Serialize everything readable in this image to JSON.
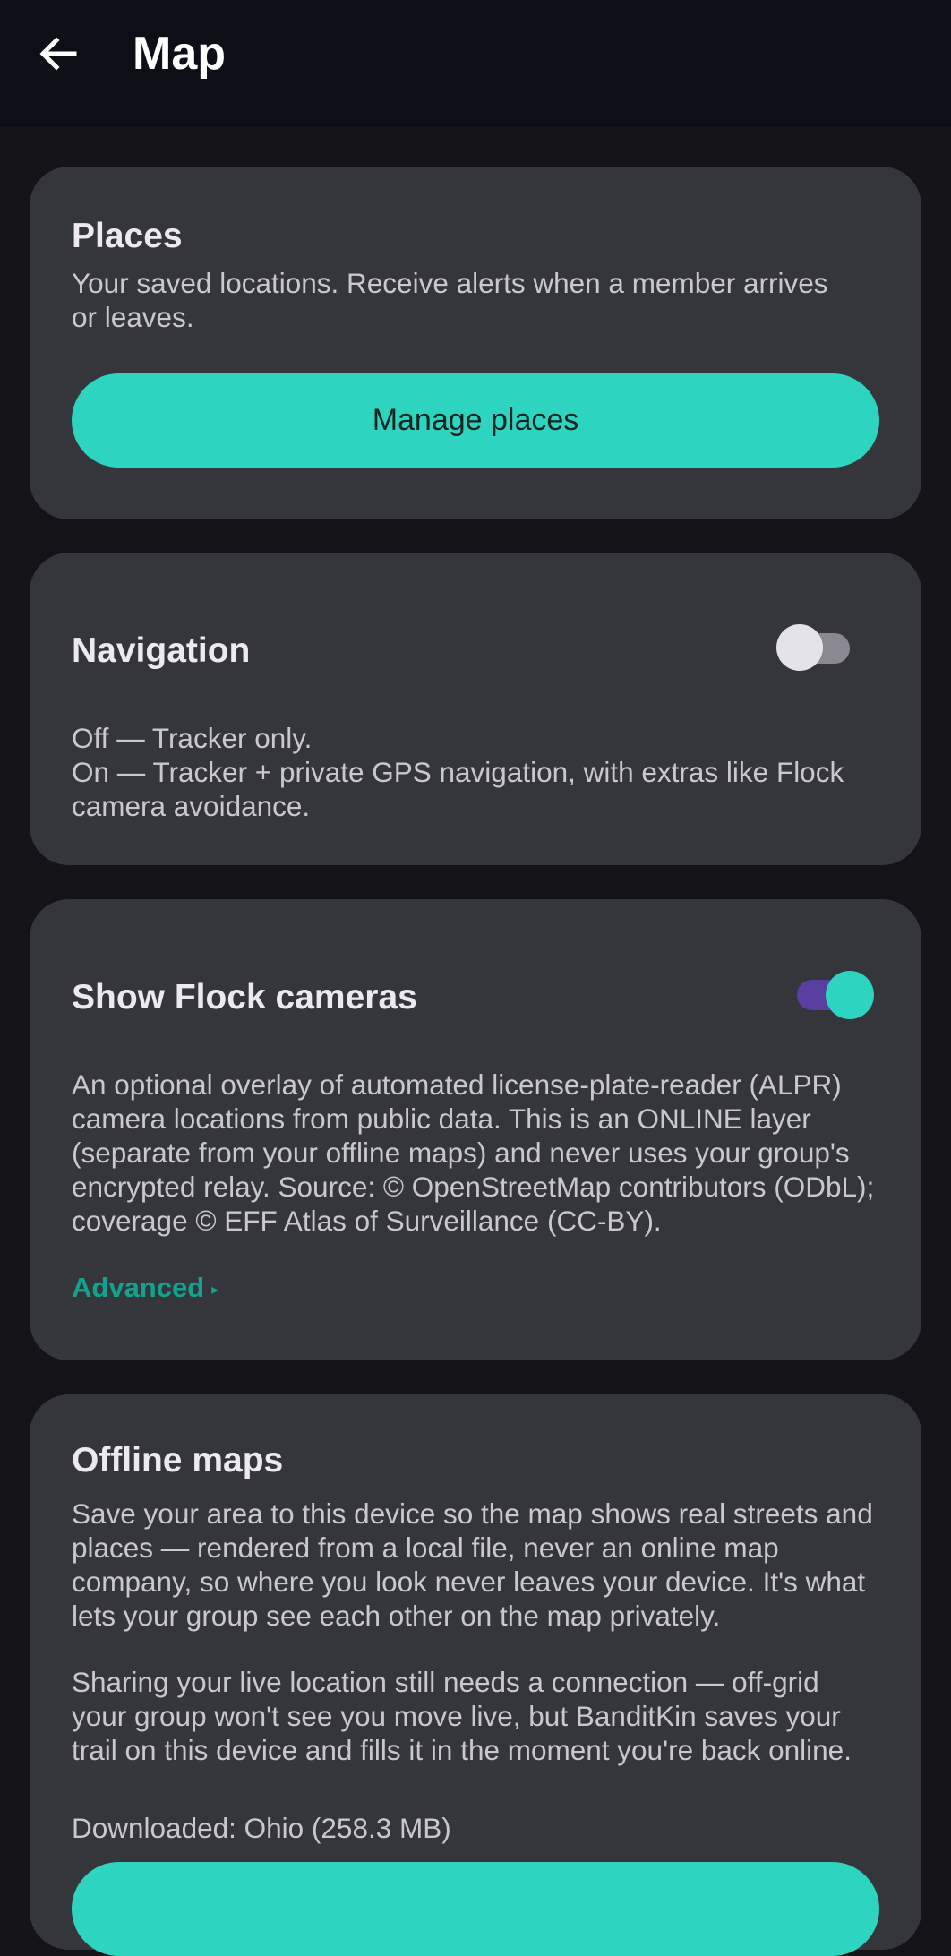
{
  "header": {
    "title": "Map",
    "back_icon": "arrow-left-icon"
  },
  "places": {
    "title": "Places",
    "description": "Your saved locations. Receive alerts when a member arrives or leaves.",
    "button_label": "Manage places"
  },
  "navigation": {
    "title": "Navigation",
    "toggle_on": false,
    "line1": "Off — Tracker only.",
    "line2": "On — Tracker + private GPS navigation, with extras like Flock camera avoidance."
  },
  "flock": {
    "title": "Show Flock cameras",
    "toggle_on": true,
    "description": "An optional overlay of automated license-plate-reader (ALPR) camera locations from public data. This is an ONLINE layer (separate from your offline maps) and never uses your group's encrypted relay. Source: © OpenStreetMap contributors (ODbL); coverage © EFF Atlas of Surveillance (CC-BY).",
    "advanced_label": "Advanced",
    "advanced_caret": "▸"
  },
  "offline": {
    "title": "Offline maps",
    "paragraph1": "Save your area to this device so the map shows real streets and places — rendered from a local file, never an online map company, so where you look never leaves your device. It's what lets your group see each other on the map privately.",
    "paragraph2": "Sharing your live location still needs a connection — off-grid your group won't see you move live, but BanditKin saves your trail on this device and fills it in the moment you're back online.",
    "downloaded": "Downloaded: Ohio (258.3 MB)"
  },
  "colors": {
    "accent": "#2dd4bf",
    "switch_on_track": "#5b3fa0",
    "switch_off_track": "#8a8991",
    "switch_off_thumb": "#e5e3ea",
    "card_bg": "#35353c",
    "page_bg": "#131318",
    "appbar_bg": "#0c0f16"
  }
}
